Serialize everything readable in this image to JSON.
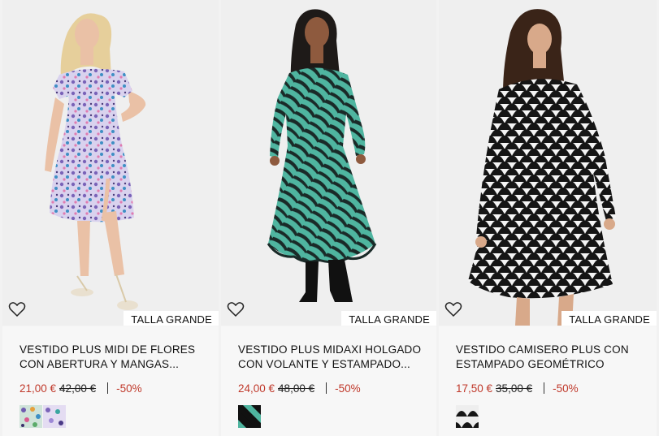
{
  "products": [
    {
      "title_line1": "VESTIDO PLUS MIDI DE FLORES",
      "title_line2": "CON ABERTURA Y MANGAS...",
      "price_now": "21,00 €",
      "price_old": "42,00 €",
      "discount": "-50%",
      "badge": "TALLA GRANDE",
      "swatches": [
        "floral-multicolor-swatch",
        "floral-lilac-swatch"
      ]
    },
    {
      "title_line1": "VESTIDO PLUS MIDAXI HOLGADO",
      "title_line2": "CON VOLANTE Y ESTAMPADO...",
      "price_now": "24,00 €",
      "price_old": "48,00 €",
      "discount": "-50%",
      "badge": "TALLA GRANDE",
      "swatches": [
        "green-zebra-swatch"
      ]
    },
    {
      "title_line1": "VESTIDO CAMISERO PLUS CON",
      "title_line2": "ESTAMPADO GEOMÉTRICO",
      "price_now": "17,50 €",
      "price_old": "35,00 €",
      "discount": "-50%",
      "badge": "TALLA GRANDE",
      "swatches": [
        "black-geometric-swatch"
      ]
    }
  ],
  "colors": {
    "sale_red": "#c0392b",
    "floral_lilac": "#b7a6d8",
    "zebra_green": "#4fb5a0",
    "geo_black": "#151515"
  }
}
